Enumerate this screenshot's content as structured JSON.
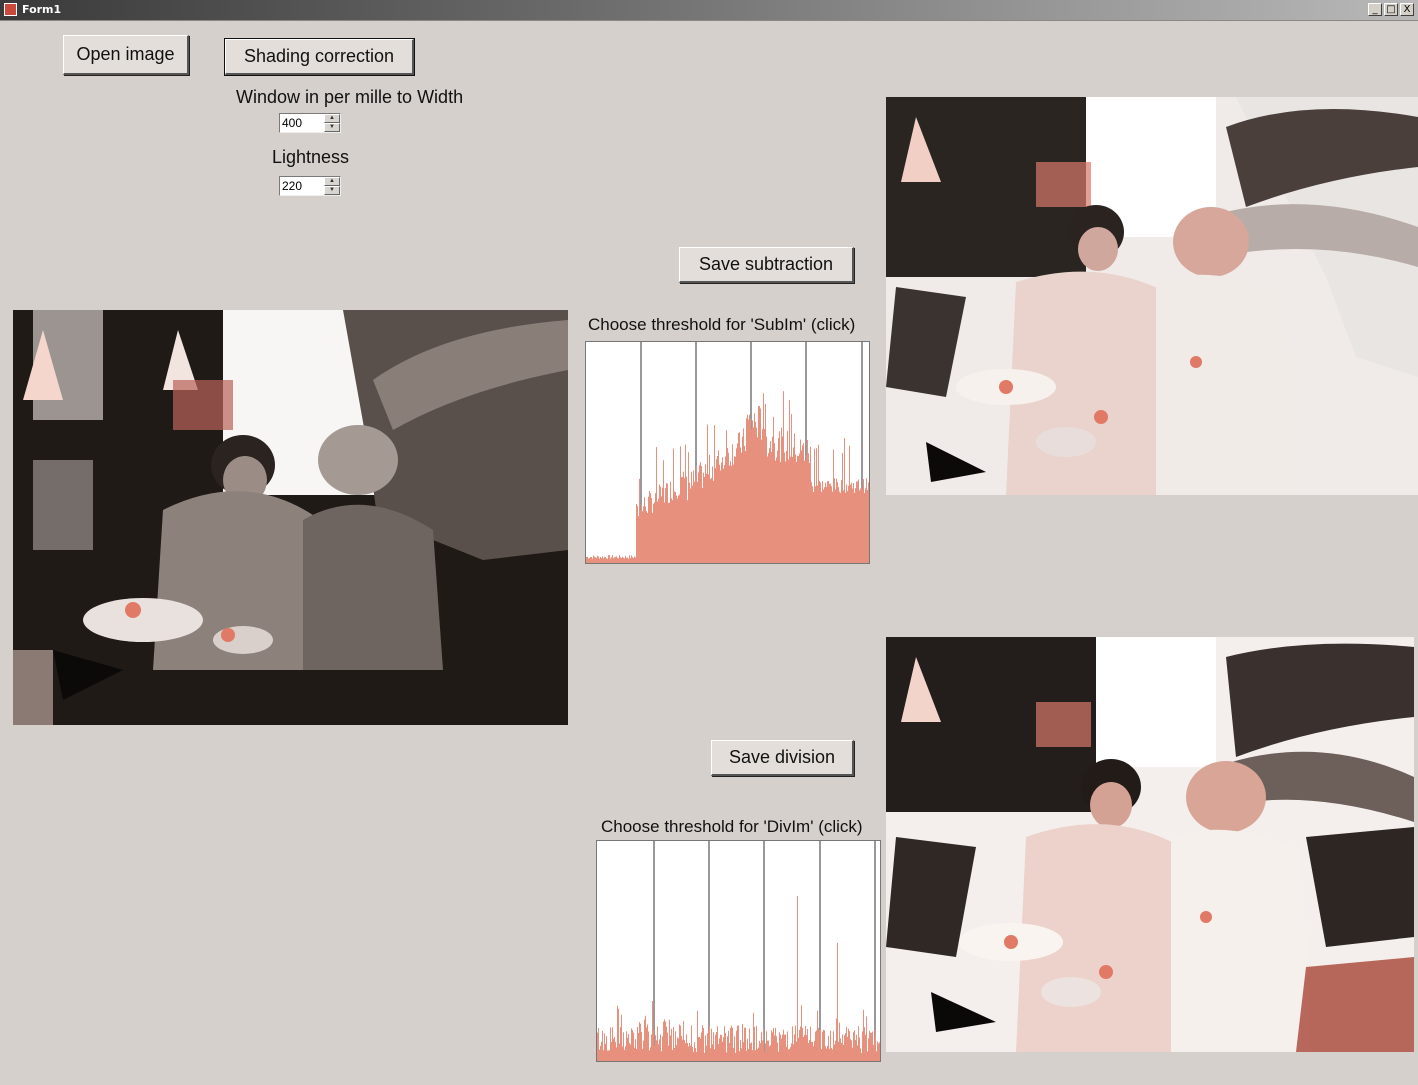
{
  "window": {
    "title": "Form1",
    "controls": [
      "_",
      "□",
      "X"
    ]
  },
  "buttons": {
    "open_image": "Open image",
    "shading_correction": "Shading correction",
    "save_subtraction": "Save subtraction",
    "save_division": "Save division"
  },
  "params": {
    "window_label": "Window in per mille to Width",
    "window_value": "400",
    "lightness_label": "Lightness",
    "lightness_value": "220"
  },
  "histograms": {
    "sub_label": "Choose threshold for 'SubIm' (click)",
    "div_label": "Choose threshold for 'DivIm' (click)",
    "bar_color": "#e8907e"
  },
  "icons": {
    "app": "form-app-icon",
    "spin": "spin-arrows-icon"
  }
}
